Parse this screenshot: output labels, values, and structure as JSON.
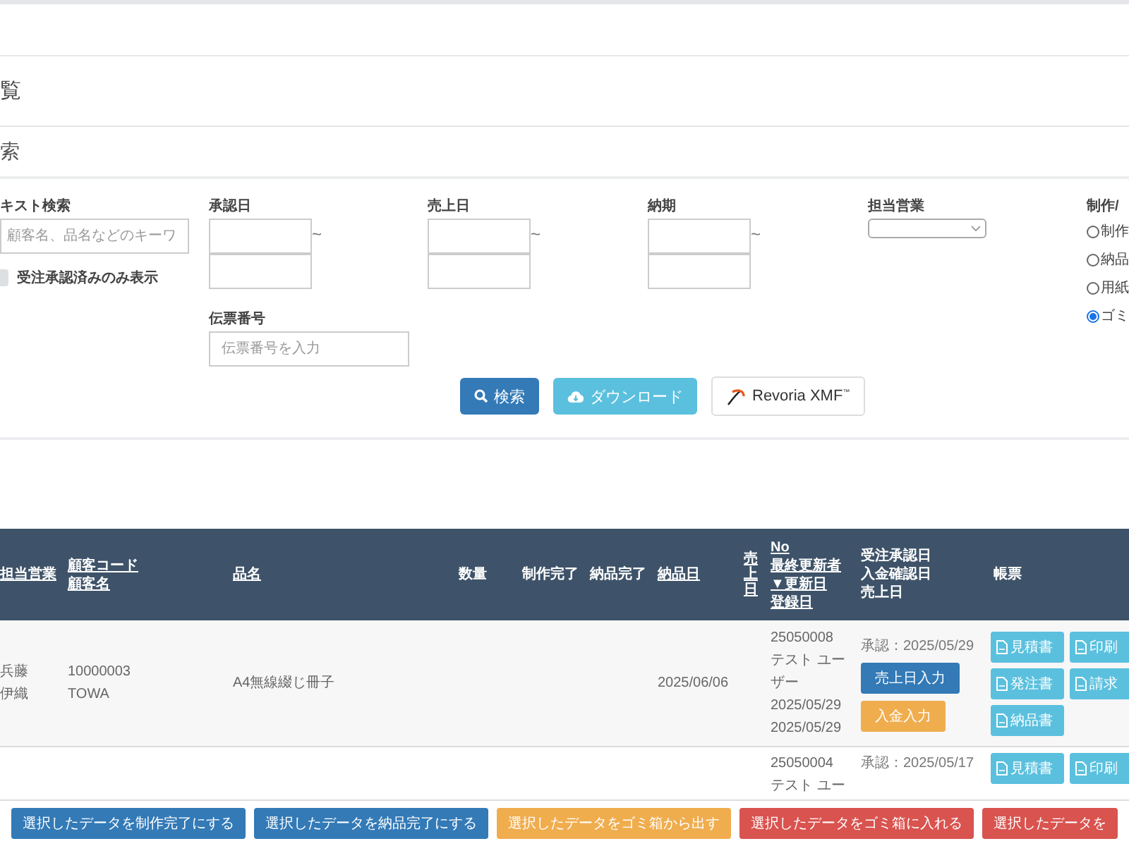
{
  "page_title": "覧",
  "search": {
    "title": "索",
    "text_search": {
      "label": "キスト検索",
      "placeholder": "顧客名、品名などのキーワ"
    },
    "approved_only": {
      "label": "受注承認済みのみ表示",
      "checked": false
    },
    "date_ranges": [
      {
        "label": "承認日",
        "separator": "~"
      },
      {
        "label": "売上日",
        "separator": "~"
      },
      {
        "label": "納期",
        "separator": "~"
      }
    ],
    "slip_number": {
      "label": "伝票番号",
      "placeholder": "伝票番号を入力"
    },
    "sales_rep": {
      "label": "担当営業"
    },
    "status_filter": {
      "label": "制作/",
      "options": [
        {
          "label": "制作",
          "selected": false
        },
        {
          "label": "納品",
          "selected": false
        },
        {
          "label": "用紙",
          "selected": false
        },
        {
          "label": "ゴミ",
          "selected": true
        }
      ]
    },
    "buttons": [
      {
        "kind": "search",
        "label": "検索"
      },
      {
        "kind": "download",
        "label": "ダウンロード"
      },
      {
        "kind": "logo",
        "label": "Revoria XMF$^{™}$"
      }
    ]
  },
  "table": {
    "columns": [
      {
        "lines": [
          "担当営業"
        ],
        "sortable": true,
        "vertical": false
      },
      {
        "lines": [
          "顧客コード",
          "顧客名"
        ],
        "sortable": true,
        "vertical": false
      },
      {
        "lines": [
          "品名"
        ],
        "sortable": true,
        "vertical": false
      },
      {
        "lines": [
          "数量"
        ],
        "sortable": false,
        "vertical": false
      },
      {
        "lines": [
          "制作完了"
        ],
        "sortable": false,
        "vertical": false
      },
      {
        "lines": [
          "納品完了"
        ],
        "sortable": false,
        "vertical": false
      },
      {
        "lines": [
          "納品日"
        ],
        "sortable": true,
        "vertical": false
      },
      {
        "lines": [
          "売上日"
        ],
        "sortable": true,
        "vertical": true
      },
      {
        "lines": [
          "No",
          "最終更新者",
          "▼更新日",
          "登録日"
        ],
        "sortable": true,
        "vertical": false
      },
      {
        "lines": [
          "受注承認日",
          "入金確認日",
          "売上日"
        ],
        "sortable": false,
        "vertical": false
      },
      {
        "lines": [
          "帳票"
        ],
        "sortable": false,
        "vertical": false
      }
    ],
    "rows": [
      {
        "sales_rep": [
          "兵藤",
          "伊織"
        ],
        "customer": [
          "10000003",
          "TOWA"
        ],
        "product": "A4無線綴じ冊子",
        "delivery_date": "2025/06/06",
        "record": [
          "25050008",
          "テスト ユーザー",
          "2025/05/29",
          "2025/05/29"
        ],
        "approval": "承認：2025/05/29",
        "actions": [
          {
            "kind": "primary",
            "label": "売上日入力"
          },
          {
            "kind": "warning",
            "label": "入金入力"
          }
        ],
        "documents": [
          "見積書",
          "印刷",
          "発注書",
          "請求",
          "納品書"
        ]
      },
      {
        "record": [
          "25050004",
          "テスト ユー"
        ],
        "approval": "承認：2025/05/17",
        "documents": [
          "見積書",
          "印刷"
        ]
      }
    ]
  },
  "bulk_actions": [
    {
      "kind": "primary",
      "label": "選択したデータを制作完了にする"
    },
    {
      "kind": "primary",
      "label": "選択したデータを納品完了にする"
    },
    {
      "kind": "warning",
      "label": "選択したデータをゴミ箱から出す"
    },
    {
      "kind": "danger",
      "label": "選択したデータをゴミ箱に入れる"
    },
    {
      "kind": "danger",
      "label": "選択したデータを"
    }
  ]
}
